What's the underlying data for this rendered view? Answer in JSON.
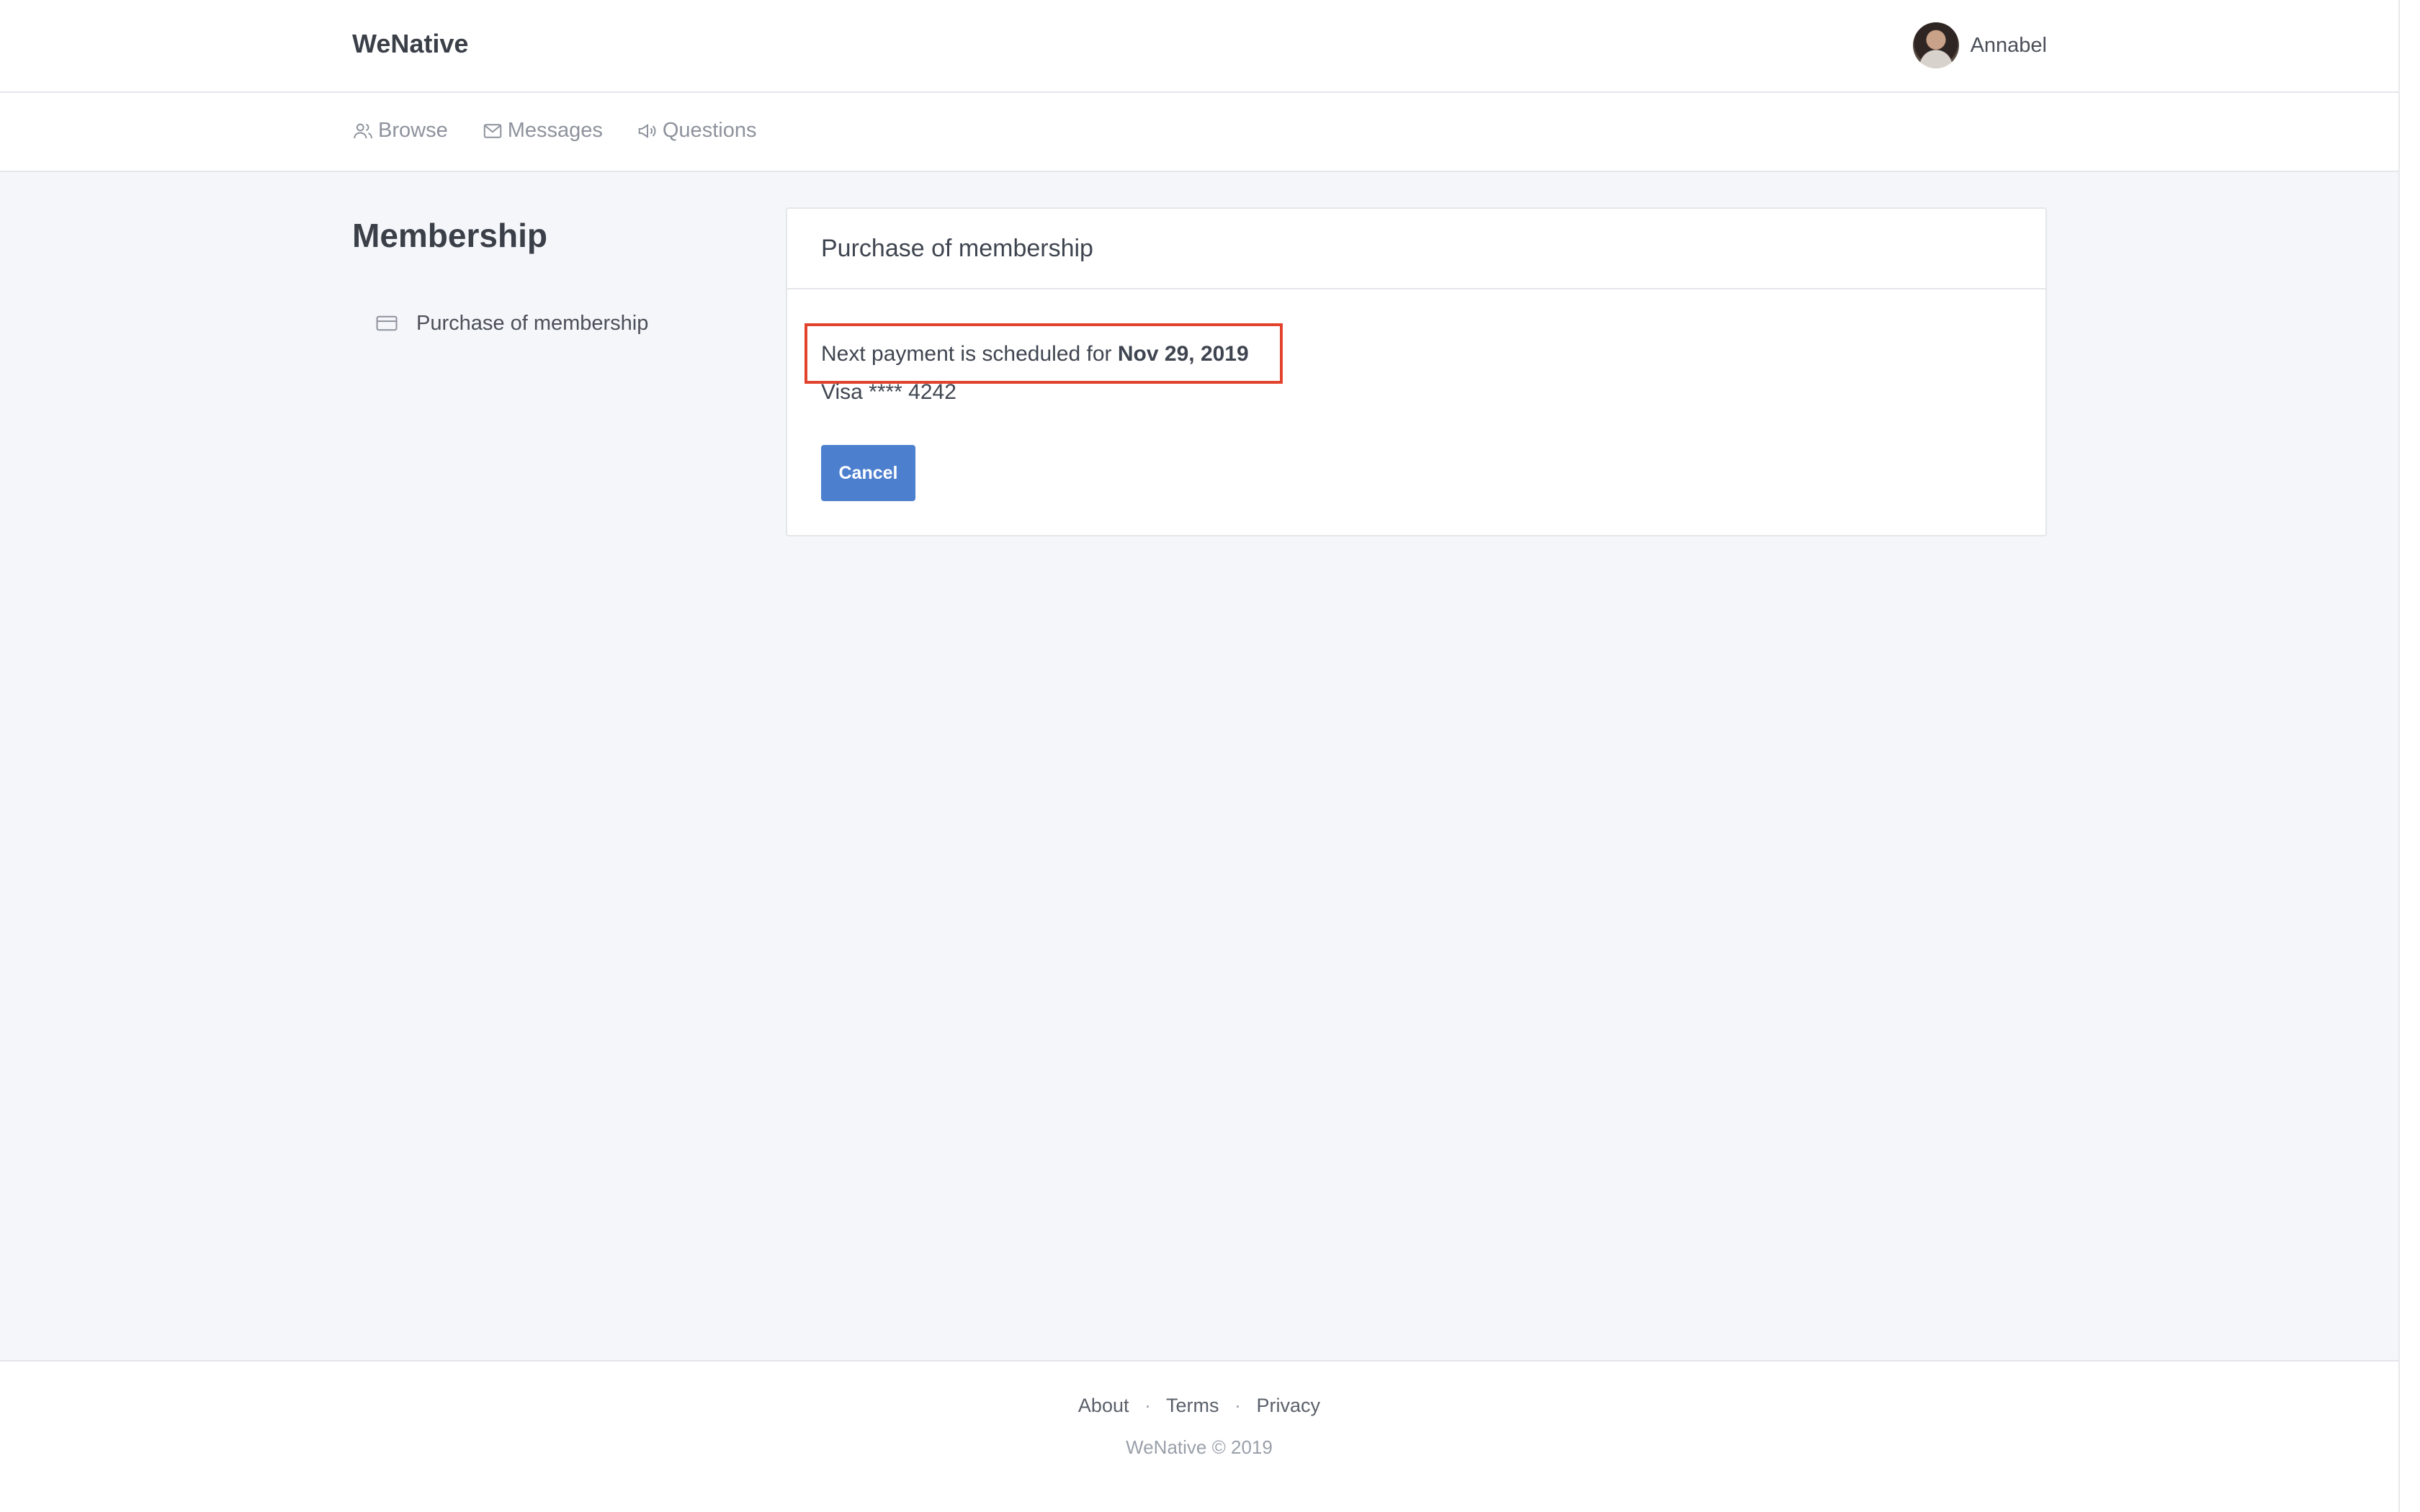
{
  "header": {
    "brand": "WeNative",
    "user_name": "Annabel"
  },
  "nav": {
    "items": [
      {
        "label": "Browse",
        "icon": "users-icon"
      },
      {
        "label": "Messages",
        "icon": "envelope-icon"
      },
      {
        "label": "Questions",
        "icon": "megaphone-icon"
      }
    ]
  },
  "sidebar": {
    "title": "Membership",
    "item_label": "Purchase of membership",
    "item_icon": "credit-card-icon"
  },
  "card": {
    "title": "Purchase of membership",
    "payment_prefix": "Next payment is scheduled for",
    "payment_date": "Nov 29, 2019",
    "card_info": "Visa **** 4242",
    "cancel_label": "Cancel"
  },
  "footer": {
    "links": [
      "About",
      "Terms",
      "Privacy"
    ],
    "separator": "·",
    "copyright": "WeNative © 2019"
  },
  "colors": {
    "accent": "#4d7fcf",
    "highlight": "#e2432d"
  }
}
